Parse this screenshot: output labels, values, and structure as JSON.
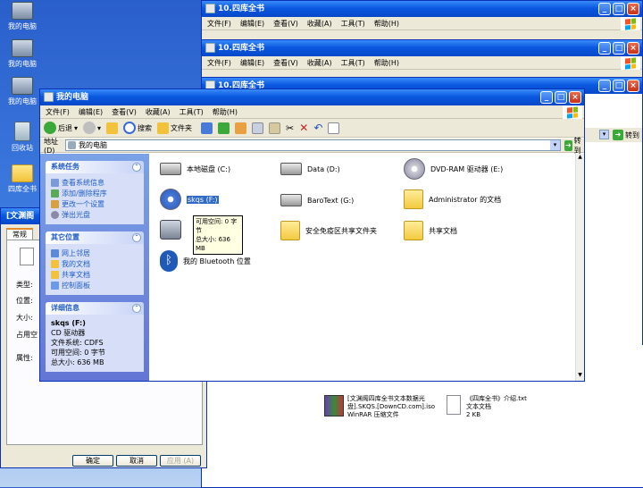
{
  "colors": {
    "title_blue": "#0a58e0",
    "task_link": "#215dc6",
    "pane_blue": "#6375d6",
    "face": "#ece9d8"
  },
  "desktop": {
    "icons": [
      {
        "label": "我的电脑",
        "icon": "computer-icon"
      },
      {
        "label": "我的电脑",
        "icon": "computer-icon"
      },
      {
        "label": "我的电脑",
        "icon": "computer-icon"
      },
      {
        "label": "回收站",
        "icon": "recycle-bin-icon"
      },
      {
        "label": "四库全书",
        "icon": "folder-icon"
      }
    ]
  },
  "bg_windows": [
    {
      "title": "10.四库全书",
      "menu": [
        "文件(F)",
        "编辑(E)",
        "查看(V)",
        "收藏(A)",
        "工具(T)",
        "帮助(H)"
      ]
    },
    {
      "title": "10.四库全书",
      "menu": [
        "文件(F)",
        "编辑(E)",
        "查看(V)",
        "收藏(A)",
        "工具(T)",
        "帮助(H)"
      ]
    },
    {
      "title": "10.四库全书",
      "go": "转到"
    }
  ],
  "main": {
    "title": "我的电脑",
    "menu": [
      "文件(F)",
      "编辑(E)",
      "查看(V)",
      "收藏(A)",
      "工具(T)",
      "帮助(H)"
    ],
    "toolbar": {
      "back": "后退",
      "search": "搜索",
      "folders": "文件夹"
    },
    "address": {
      "label": "地址(D)",
      "value": "我的电脑",
      "go": "转到"
    },
    "system_tasks": {
      "title": "系统任务",
      "items": [
        "查看系统信息",
        "添加/删除程序",
        "更改一个设置",
        "弹出光盘"
      ]
    },
    "other_places": {
      "title": "其它位置",
      "items": [
        "网上邻居",
        "我的文档",
        "共享文档",
        "控制面板"
      ]
    },
    "details": {
      "title": "详细信息",
      "name": "skqs (F:)",
      "type": "CD 驱动器",
      "fs": "文件系统: CDFS",
      "free": "可用空间: 0 字节",
      "total": "总大小: 636 MB"
    },
    "items": [
      {
        "label": "本地磁盘 (C:)",
        "icon": "hard-drive-icon"
      },
      {
        "label": "Data (D:)",
        "icon": "hard-drive-icon"
      },
      {
        "label": "DVD-RAM 驱动器 (E:)",
        "icon": "dvd-drive-icon"
      },
      {
        "label": "skqs (F:)",
        "icon": "cd-drive-icon"
      },
      {
        "label": "BaroText (G:)",
        "icon": "hard-drive-icon"
      },
      {
        "label": "Administrator 的文档",
        "icon": "folder-icon"
      },
      {
        "label": "",
        "icon": "camera-icon"
      },
      {
        "label": "安全免疫区共享文件夹",
        "icon": "shared-folder-icon"
      },
      {
        "label": "共享文档",
        "icon": "folder-icon"
      },
      {
        "label": "我的 Bluetooth 位置",
        "icon": "bluetooth-icon"
      }
    ],
    "tooltip": {
      "line1": "可用空间: 0 字节",
      "line2": "总大小: 636 MB"
    }
  },
  "props": {
    "title": "[文渊阁",
    "tab": "常规",
    "labels": [
      "类型:",
      "位置:",
      "大小:",
      "占用空",
      "属性:"
    ],
    "buttons": {
      "ok": "确定",
      "cancel": "取消",
      "apply": "应用 (A)"
    }
  },
  "archive": {
    "files": [
      {
        "name": "[文渊阁四库全书文本数据光盘].SKQS.[DownCD.com].iso",
        "type": "WinRAR 压缩文件",
        "icon": "winrar-icon"
      },
      {
        "name": "《四库全书》介绍.txt",
        "type": "文本文档",
        "size": "2 KB",
        "icon": "text-file-icon"
      }
    ],
    "partial_type": "WinRAR 压缩文件"
  }
}
